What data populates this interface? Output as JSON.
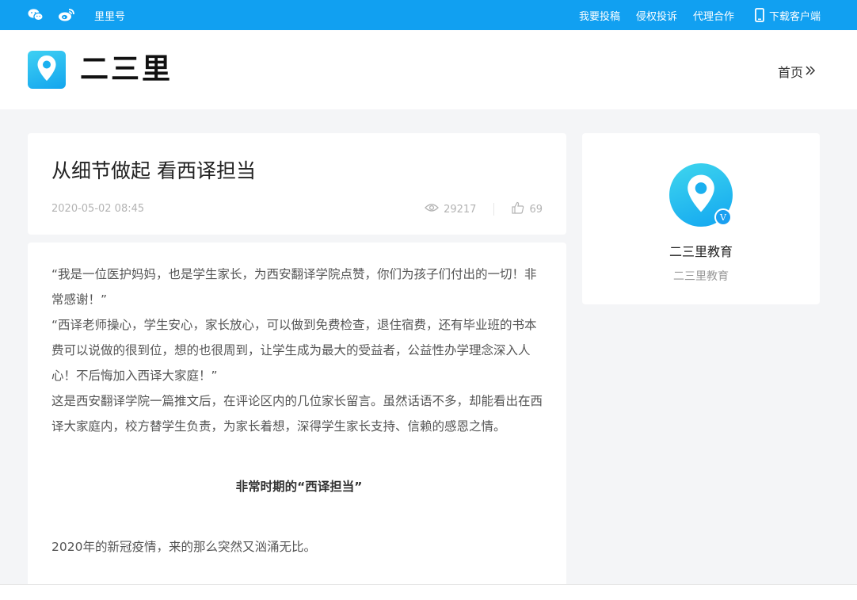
{
  "topbar": {
    "icons": [
      "wechat-icon",
      "weibo-icon"
    ],
    "left_link": "里里号",
    "links": [
      "我要投稿",
      "侵权投诉",
      "代理合作"
    ],
    "download": "下载客户端"
  },
  "header": {
    "brand": "二三里",
    "home": "首页"
  },
  "article": {
    "title": "从细节做起 看西译担当",
    "date": "2020-05-02 08:45",
    "views": "29217",
    "likes": "69",
    "paragraphs": [
      "“我是一位医护妈妈，也是学生家长，为西安翻译学院点赞，你们为孩子们付出的一切！非常感谢！”",
      "“西译老师操心，学生安心，家长放心，可以做到免费检查，退住宿费，还有毕业班的书本费可以说做的很到位，想的也很周到，让学生成为最大的受益者，公益性办学理念深入人心！不后悔加入西译大家庭！”",
      "这是西安翻译学院一篇推文后，在评论区内的几位家长留言。虽然话语不多，却能看出在西译大家庭内，校方替学生负责，为家长着想，深得学生家长支持、信赖的感恩之情。"
    ],
    "subhead": "非常时期的“西译担当”",
    "last_paragraph": "2020年的新冠疫情，来的那么突然又汹涌无比。"
  },
  "sidebar": {
    "name": "二三里教育",
    "sub": "二三里教育",
    "badge": "V"
  },
  "colors": {
    "topbar": "#11a0f1",
    "background": "#f4f5f7",
    "accent": "#13a5ee"
  }
}
